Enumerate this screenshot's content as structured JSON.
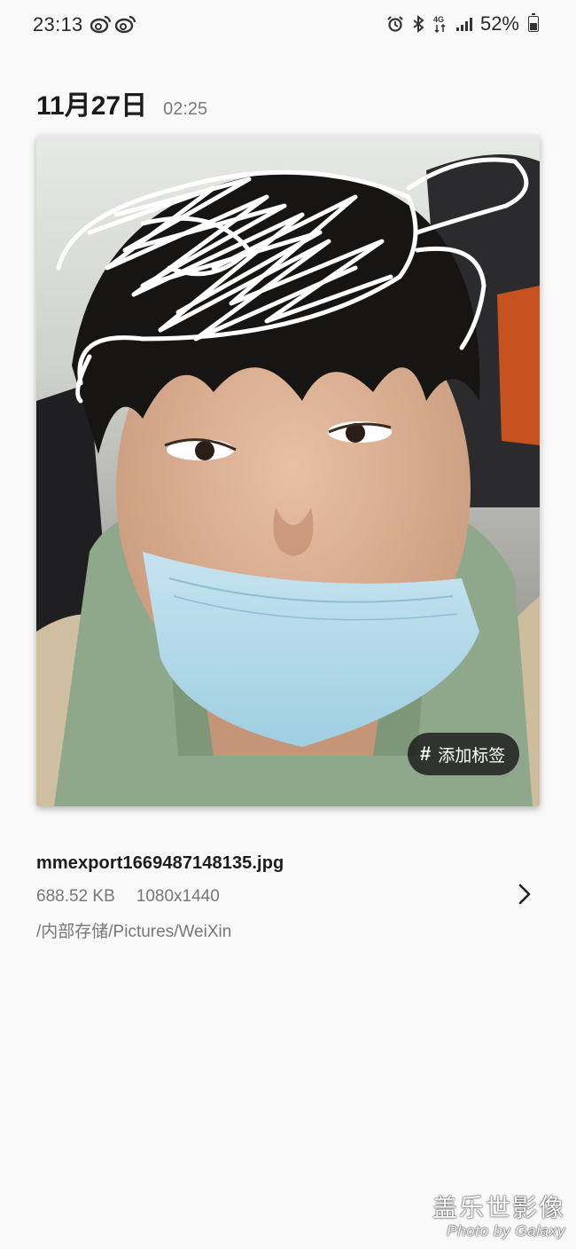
{
  "status_bar": {
    "time": "23:13",
    "left_icons": [
      "weibo-icon",
      "weibo-icon"
    ],
    "right_icons": [
      "alarm-icon",
      "bluetooth-icon",
      "4g-icon",
      "signal-icon"
    ],
    "battery_text": "52%",
    "battery_level": 0.52
  },
  "header": {
    "date": "11月27日",
    "time": "02:25"
  },
  "photo": {
    "tag_button_label": "添加标签",
    "tag_icon": "hashtag-icon"
  },
  "file": {
    "name": "mmexport1669487148135.jpg",
    "size": "688.52 KB",
    "resolution": "1080x1440",
    "path": "/内部存储/Pictures/WeiXin",
    "details_icon": "chevron-right-icon"
  },
  "watermark": {
    "title": "盖乐世影像",
    "subtitle": "Photo by Galaxy"
  }
}
